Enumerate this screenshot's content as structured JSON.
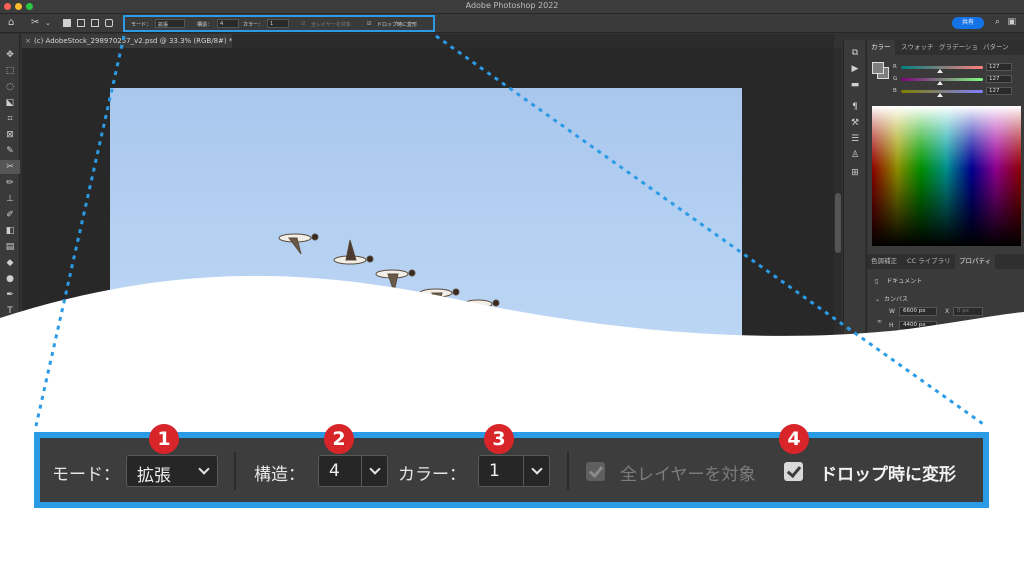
{
  "window": {
    "title": "Adobe Photoshop 2022"
  },
  "options_bar": {
    "mode_label": "モード：",
    "mode_value": "拡張",
    "structure_label": "構造：",
    "structure_value": "4",
    "color_label": "カラー：",
    "color_value": "1",
    "all_layers_label": "全レイヤーを対象",
    "transform_on_drop_label": "ドロップ時に変形",
    "share_label": "共有"
  },
  "document_tab": {
    "title": "(c) AdobeStock_298970257_v2.psd @ 33.3% (RGB/8#) *"
  },
  "panels": {
    "color_tabs": [
      "カラー",
      "スウォッチ",
      "グラデーショ",
      "パターン"
    ],
    "rgb": [
      {
        "label": "R",
        "value": "127"
      },
      {
        "label": "G",
        "value": "127"
      },
      {
        "label": "B",
        "value": "127"
      }
    ],
    "lower_tabs": [
      "色調補正",
      "CC ライブラリ",
      "プロパティ"
    ],
    "document_label": "ドキュメント",
    "canvas_section": "カンバス",
    "width_label": "W",
    "width_value": "6600 px",
    "height_label": "H",
    "height_value": "4400 px",
    "x_label": "X",
    "x_placeholder": "0 px"
  },
  "zoom": {
    "mode_label": "モード：",
    "mode_value": "拡張",
    "structure_label": "構造：",
    "structure_value": "4",
    "color_label": "カラー：",
    "color_value": "1",
    "all_layers_label": "全レイヤーを対象",
    "transform_on_drop_label": "ドロップ時に変形",
    "all_layers_checked": true,
    "all_layers_disabled": true,
    "transform_on_drop_checked": true
  },
  "badges": [
    "1",
    "2",
    "3",
    "4"
  ],
  "colors": {
    "highlight": "#2b9be6",
    "badge": "#d8252a",
    "share": "#1473e6"
  }
}
